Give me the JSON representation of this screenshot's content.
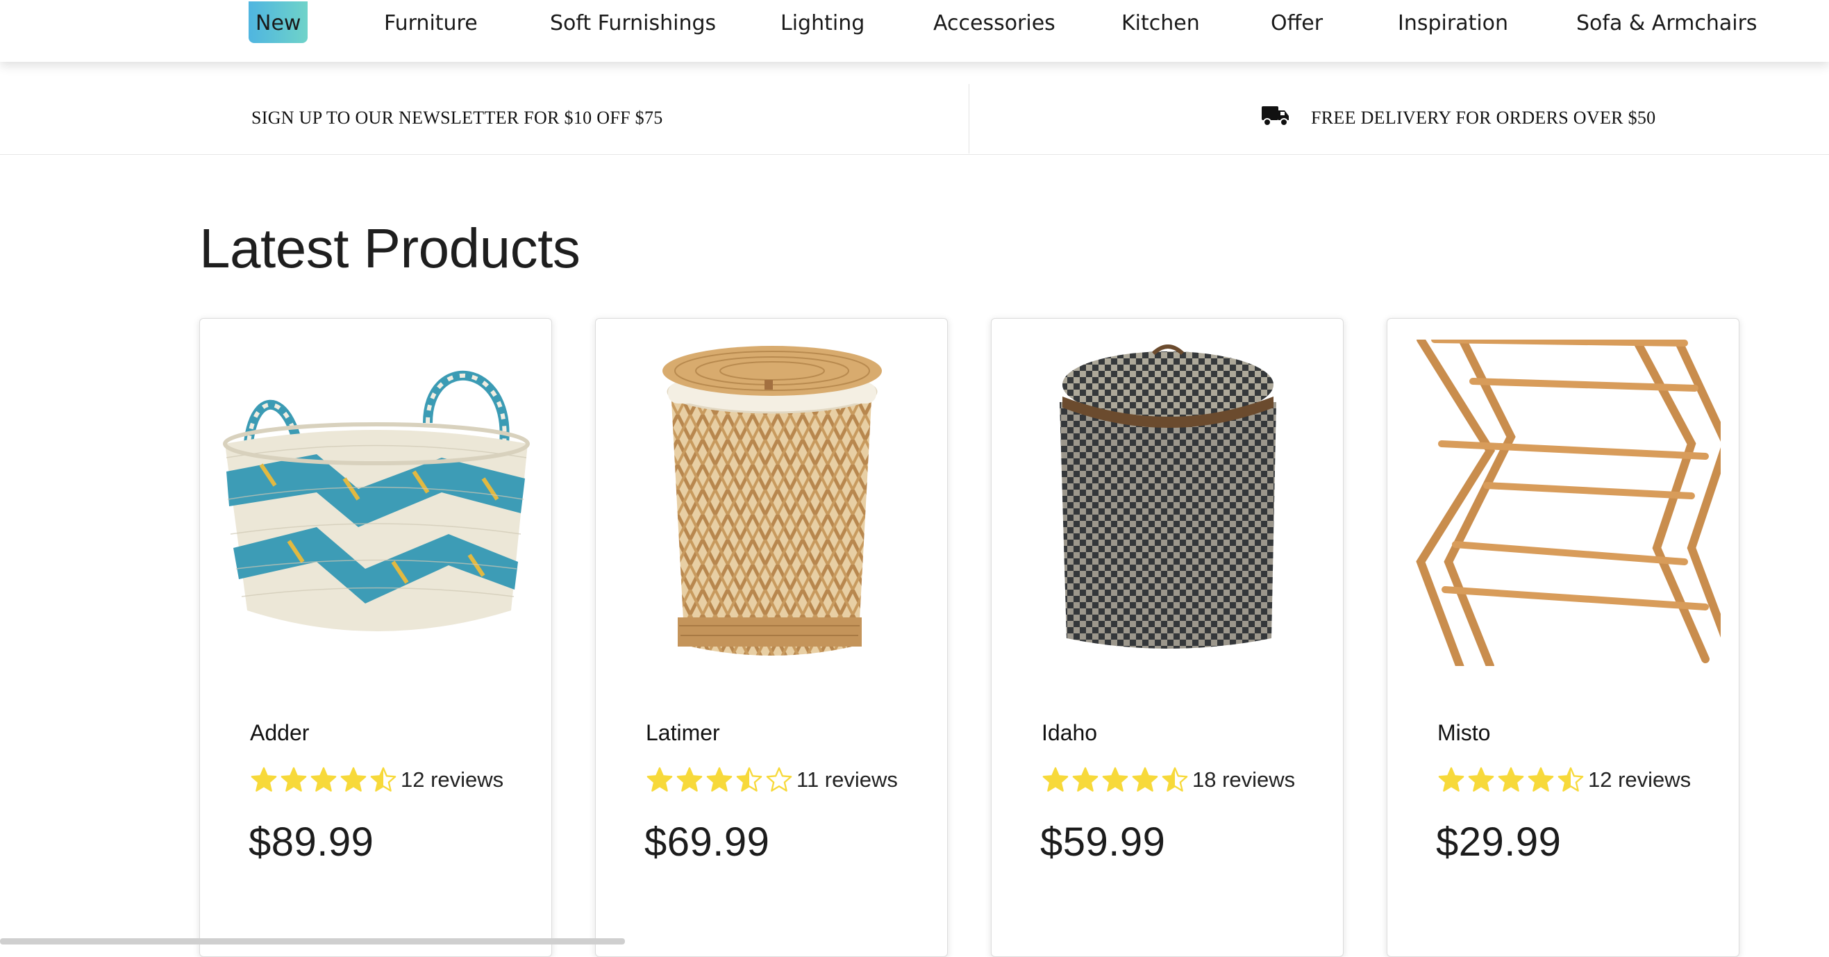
{
  "nav": {
    "items": [
      "New",
      "Furniture",
      "Soft Furnishings",
      "Lighting",
      "Accessories",
      "Kitchen",
      "Offer",
      "Inspiration",
      "Sofa & Armchairs"
    ]
  },
  "promo": {
    "newsletter": "SIGN UP TO OUR NEWSLETTER FOR $10 OFF $75",
    "delivery": "FREE DELIVERY FOR ORDERS OVER $50",
    "delivery_icon": "truck-icon"
  },
  "section": {
    "title": "Latest Products"
  },
  "colors": {
    "star": "#f7d93a",
    "accent": "#4fb5e0"
  },
  "products": [
    {
      "name": "Adder",
      "rating": 4.5,
      "reviews": "12 reviews",
      "price": "$89.99",
      "image": "woven-basket-blue"
    },
    {
      "name": "Latimer",
      "rating": 3.5,
      "reviews": "11 reviews",
      "price": "$69.99",
      "image": "wicker-laundry-hamper"
    },
    {
      "name": "Idaho",
      "rating": 4.5,
      "reviews": "18 reviews",
      "price": "$59.99",
      "image": "black-woven-hamper"
    },
    {
      "name": "Misto",
      "rating": 4.5,
      "reviews": "12 reviews",
      "price": "$29.99",
      "image": "wooden-drying-rack"
    }
  ]
}
